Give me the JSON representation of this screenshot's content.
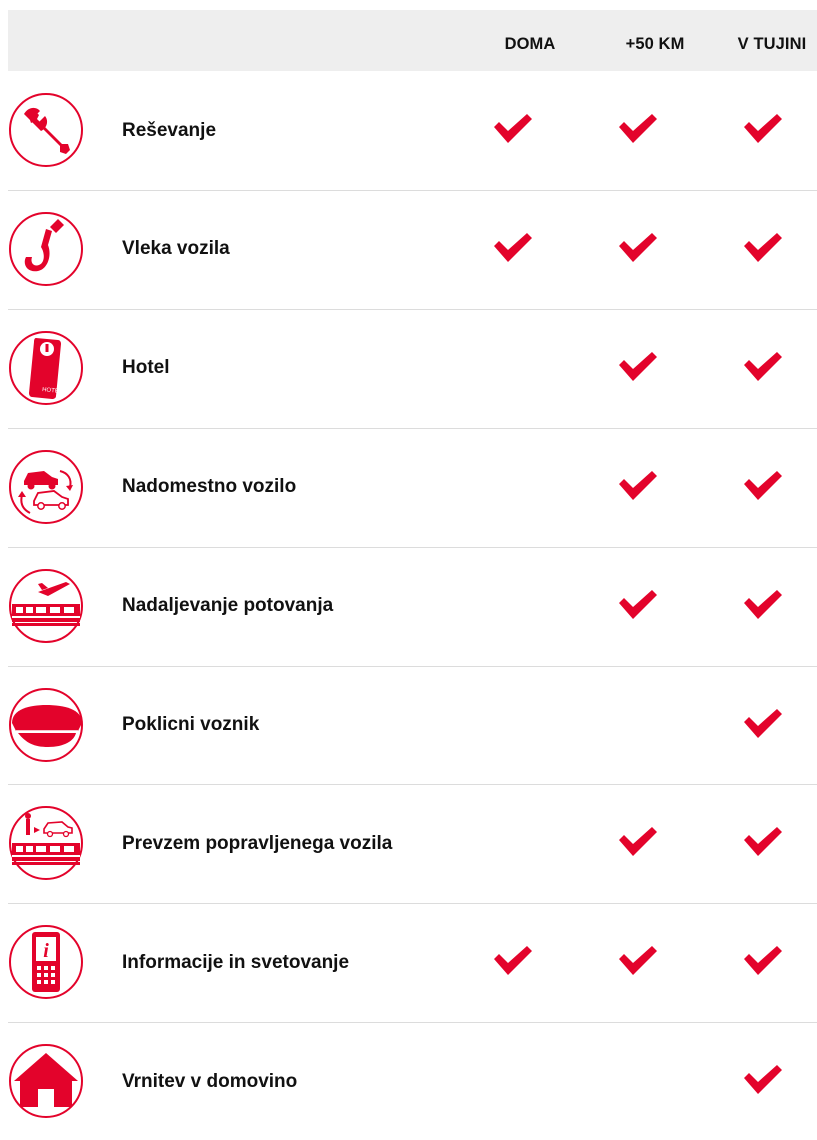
{
  "header": {
    "col_home": "DOMA",
    "col_50km": "+50 KM",
    "col_abroad": "V TUJINI"
  },
  "colors": {
    "accent": "#e3032b",
    "header_bg": "#eeeeee",
    "divider": "#dcdcdc"
  },
  "rows": [
    {
      "label": "Reševanje",
      "icon": "wrench-icon",
      "doma": true,
      "km50": true,
      "tujina": true
    },
    {
      "label": "Vleka vozila",
      "icon": "tow-hook-icon",
      "doma": true,
      "km50": true,
      "tujina": true
    },
    {
      "label": "Hotel",
      "icon": "hotel-door-hanger-icon",
      "doma": false,
      "km50": true,
      "tujina": true
    },
    {
      "label": "Nadomestno vozilo",
      "icon": "replacement-car-icon",
      "doma": false,
      "km50": true,
      "tujina": true
    },
    {
      "label": "Nadaljevanje potovanja",
      "icon": "plane-train-icon",
      "doma": false,
      "km50": true,
      "tujina": true
    },
    {
      "label": "Poklicni voznik",
      "icon": "chauffeur-cap-icon",
      "doma": false,
      "km50": false,
      "tujina": true
    },
    {
      "label": "Prevzem popravljenega vozila",
      "icon": "pickup-repaired-car-icon",
      "doma": false,
      "km50": true,
      "tujina": true
    },
    {
      "label": "Informacije in svetovanje",
      "icon": "info-phone-icon",
      "doma": true,
      "km50": true,
      "tujina": true
    },
    {
      "label": "Vrnitev v domovino",
      "icon": "home-icon",
      "doma": false,
      "km50": false,
      "tujina": true
    }
  ]
}
